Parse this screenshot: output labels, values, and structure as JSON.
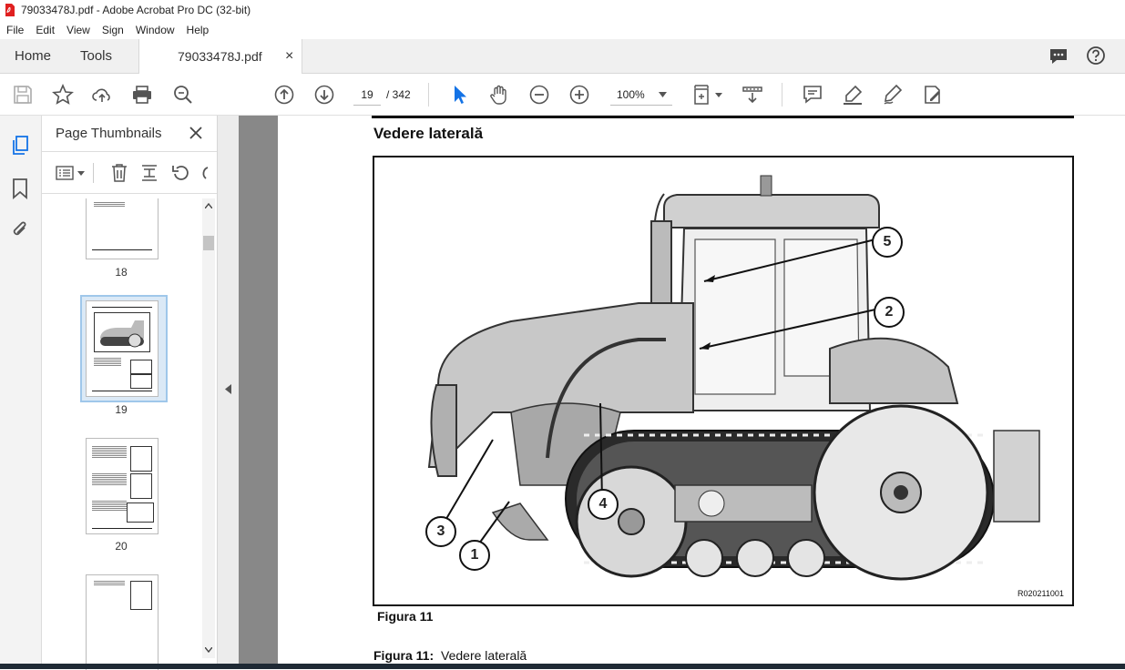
{
  "window": {
    "title": "79033478J.pdf - Adobe Acrobat Pro DC (32-bit)"
  },
  "menu": [
    "File",
    "Edit",
    "View",
    "Sign",
    "Window",
    "Help"
  ],
  "tabs": {
    "home": "Home",
    "tools": "Tools",
    "document": "79033478J.pdf",
    "close": "×"
  },
  "toolbar": {
    "page_current": "19",
    "page_total": "/ 342",
    "zoom": "100%"
  },
  "sidebar": {
    "title": "Page Thumbnails",
    "thumbnails": [
      {
        "label": "18"
      },
      {
        "label": "19",
        "selected": true
      },
      {
        "label": "20"
      }
    ]
  },
  "document": {
    "section_title": "Vedere laterală",
    "figure_code": "R020211001",
    "callouts": [
      "1",
      "2",
      "3",
      "4",
      "5"
    ],
    "figure_label": "Figura 11",
    "caption_label": "Figura 11:",
    "caption_text": "Vedere laterală"
  },
  "colors": {
    "accent": "#1473e6",
    "selected_thumb": "#9fc7ea",
    "gray_bg": "#888888"
  }
}
